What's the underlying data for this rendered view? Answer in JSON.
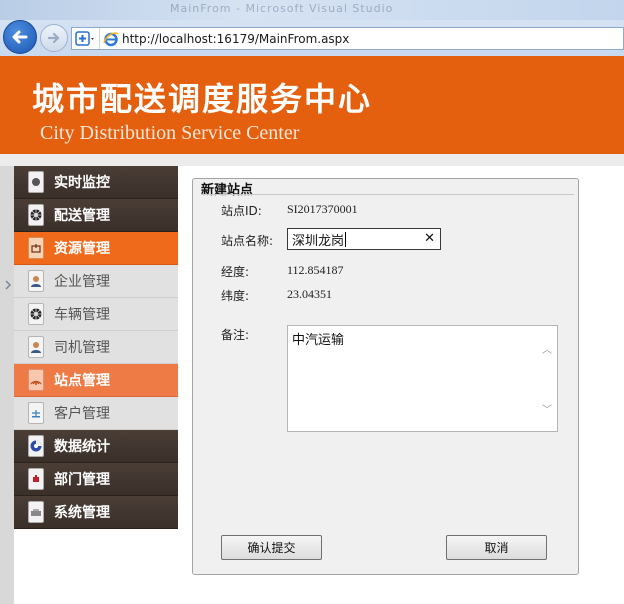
{
  "browser": {
    "tab_title_ghost": "MainFrom - Microsoft Visual Studio",
    "url": "http://localhost:16179/MainFrom.aspx"
  },
  "header": {
    "title": "城市配送调度服务中心",
    "subtitle": "City Distribution Service Center"
  },
  "sidebar": {
    "items": [
      {
        "label": "实时监控",
        "icon": "monitor-icon"
      },
      {
        "label": "配送管理",
        "icon": "wheel-icon"
      },
      {
        "label": "资源管理",
        "icon": "resource-icon"
      },
      {
        "label": "企业管理",
        "icon": "user-icon"
      },
      {
        "label": "车辆管理",
        "icon": "wheel-icon"
      },
      {
        "label": "司机管理",
        "icon": "user-icon"
      },
      {
        "label": "站点管理",
        "icon": "signal-icon"
      },
      {
        "label": "客户管理",
        "icon": "customer-icon"
      },
      {
        "label": "数据统计",
        "icon": "chart-icon"
      },
      {
        "label": "部门管理",
        "icon": "department-icon"
      },
      {
        "label": "系统管理",
        "icon": "system-icon"
      }
    ]
  },
  "form": {
    "title": "新建站点",
    "station_id_label": "站点ID:",
    "station_id_value": "SI2017370001",
    "station_name_label": "站点名称:",
    "station_name_value": "深圳龙岗",
    "longitude_label": "经度:",
    "longitude_value": "112.854187",
    "latitude_label": "纬度:",
    "latitude_value": "23.04351",
    "remark_label": "备注:",
    "remark_value": "中汽运输",
    "submit_label": "确认提交",
    "cancel_label": "取消"
  },
  "colors": {
    "brand_orange": "#e4600f",
    "nav_dark": "#3f342e",
    "nav_active": "#f06a1c"
  }
}
